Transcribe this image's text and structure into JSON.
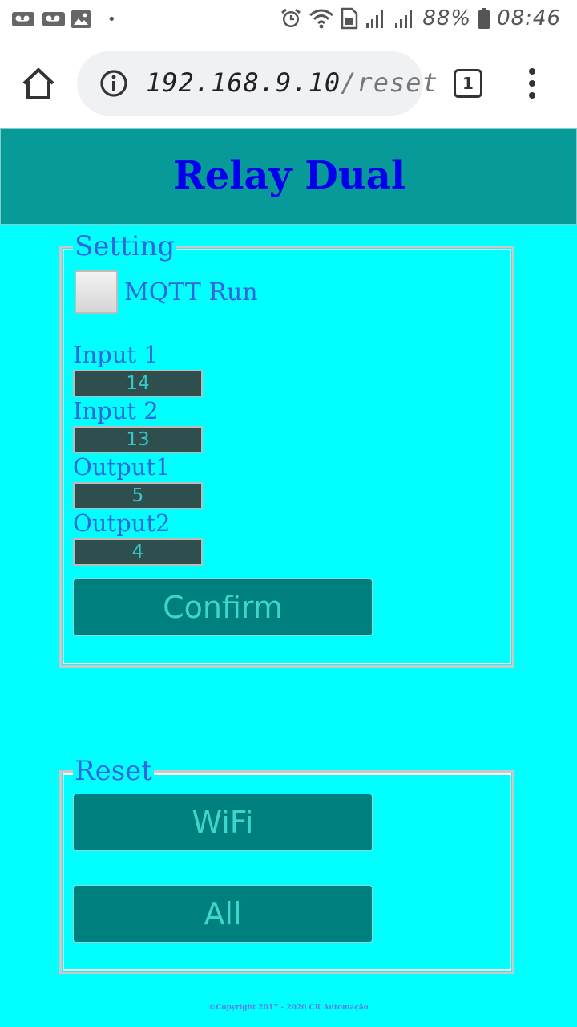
{
  "status_bar": {
    "battery_percent": "88%",
    "time": "08:46"
  },
  "browser": {
    "url_host": "192.168.9.10",
    "url_path": "/reset",
    "tab_count": "1"
  },
  "page": {
    "title": "Relay Dual"
  },
  "setting": {
    "legend": "Setting",
    "mqtt_label": "MQTT Run",
    "mqtt_checked": false,
    "fields": [
      {
        "label": "Input 1",
        "value": "14"
      },
      {
        "label": "Input 2",
        "value": "13"
      },
      {
        "label": "Output1",
        "value": "5"
      },
      {
        "label": "Output2",
        "value": "4"
      }
    ],
    "confirm_label": "Confirm"
  },
  "reset": {
    "legend": "Reset",
    "wifi_label": "WiFi",
    "all_label": "All"
  },
  "footer": {
    "copyright": "©Copyright 2017 - 2020 CR Automação"
  },
  "colors": {
    "page_background": "#00ffff",
    "header_background": "#089999",
    "title_color": "#0000ee",
    "button_background": "#007f7f",
    "input_background": "#2f4f4f"
  }
}
